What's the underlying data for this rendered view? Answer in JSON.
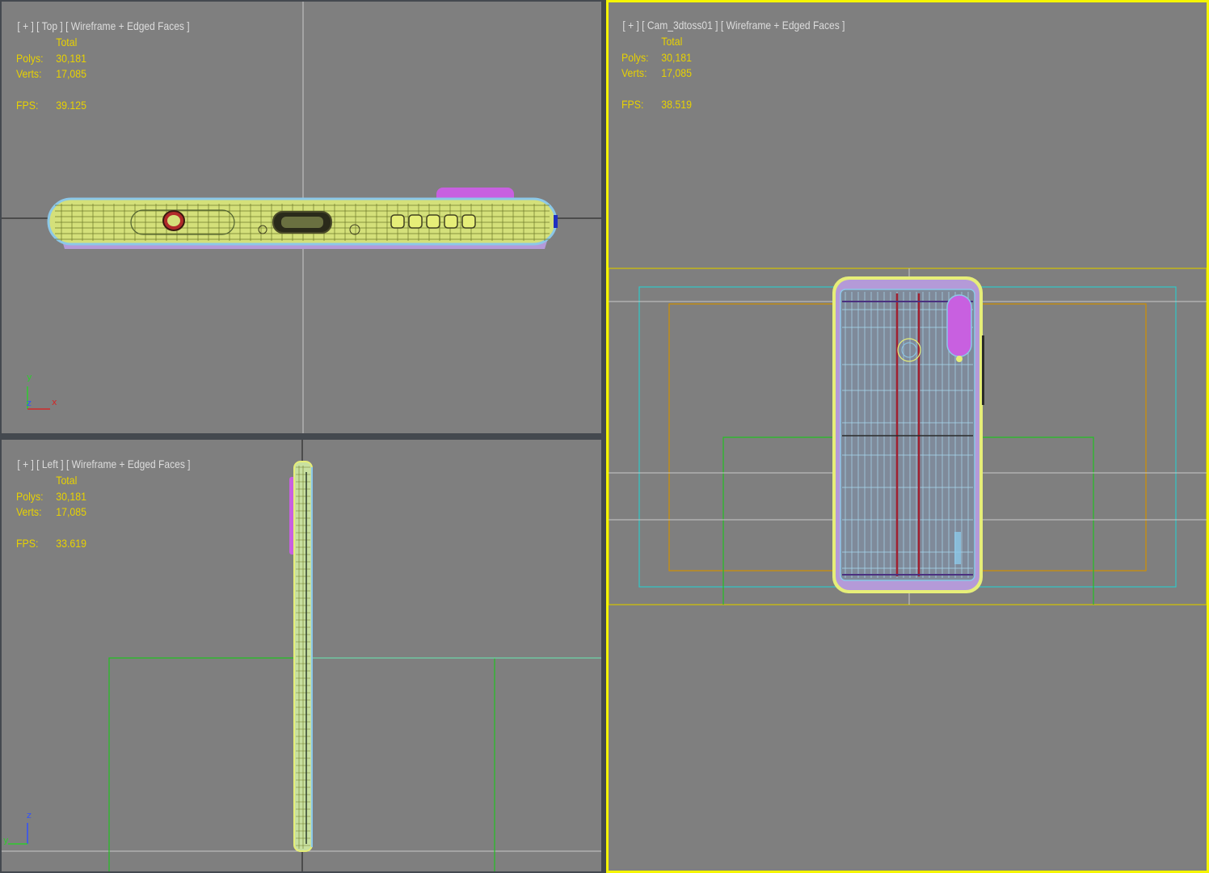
{
  "viewports": {
    "top": {
      "label_plus": "[ + ]",
      "label_view": "[ Top ]",
      "label_mode": "[ Wireframe + Edged Faces ]",
      "stats": {
        "header": "Total",
        "polys_label": "Polys:",
        "polys": "30,181",
        "verts_label": "Verts:",
        "verts": "17,085",
        "fps_label": "FPS:",
        "fps": "39.125"
      },
      "axes": {
        "y": "y",
        "z": "z",
        "x": "x"
      }
    },
    "left": {
      "label_plus": "[ + ]",
      "label_view": "[ Left ]",
      "label_mode": "[ Wireframe + Edged Faces ]",
      "stats": {
        "header": "Total",
        "polys_label": "Polys:",
        "polys": "30,181",
        "verts_label": "Verts:",
        "verts": "17,085",
        "fps_label": "FPS:",
        "fps": "33.619"
      },
      "axes": {
        "z": "z",
        "y": "y"
      }
    },
    "cam": {
      "label_plus": "[ + ]",
      "label_view": "[ Cam_3dtoss01 ]",
      "label_mode": "[ Wireframe + Edged Faces ]",
      "stats": {
        "header": "Total",
        "polys_label": "Polys:",
        "polys": "30,181",
        "verts_label": "Verts:",
        "verts": "17,085",
        "fps_label": "FPS:",
        "fps": "38.519"
      },
      "active": true
    }
  },
  "colors": {
    "viewport_bg": "#7f7f7f",
    "active_border": "#f5f500",
    "stats_text": "#e8d200",
    "label_text": "#dcdcdc",
    "wire_yellow": "#e6ee78",
    "wire_blue": "#8cc8e8",
    "accent_magenta": "#c860e0",
    "safe_frame_green": "#22c022",
    "safe_frame_cyan": "#30c8c8",
    "safe_frame_orange": "#d09000",
    "safe_frame_yellow": "#d4c400"
  }
}
